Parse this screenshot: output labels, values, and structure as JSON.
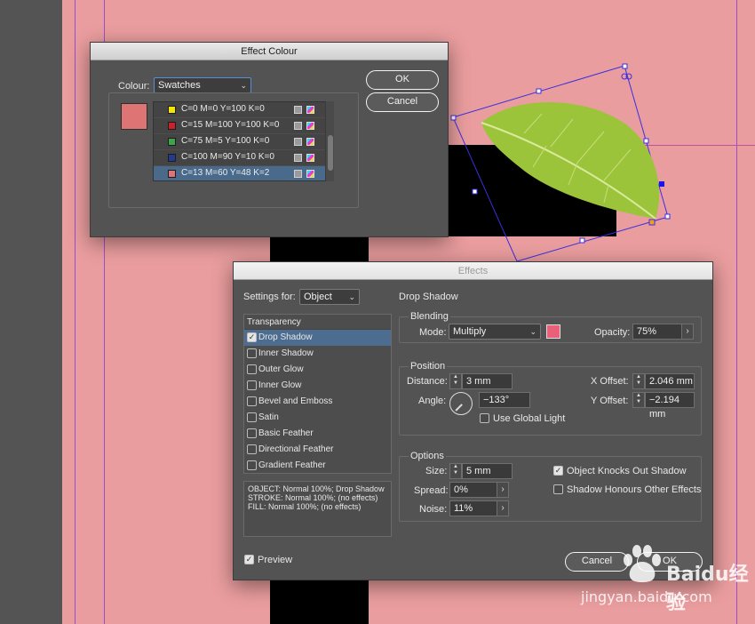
{
  "effect_colour_dialog": {
    "title": "Effect Colour",
    "colour_label": "Colour:",
    "colour_value": "Swatches",
    "ok_label": "OK",
    "cancel_label": "Cancel",
    "preview_color": "#de7474",
    "swatches": [
      {
        "name": "C=0 M=0 Y=100 K=0",
        "color": "#f2e600",
        "selected": false
      },
      {
        "name": "C=15 M=100 Y=100 K=0",
        "color": "#c8202c",
        "selected": false
      },
      {
        "name": "C=75 M=5 Y=100 K=0",
        "color": "#3ca54a",
        "selected": false
      },
      {
        "name": "C=100 M=90 Y=10 K=0",
        "color": "#223b8f",
        "selected": false
      },
      {
        "name": "C=13 M=60 Y=48 K=2",
        "color": "#de7474",
        "selected": true
      }
    ]
  },
  "effects_dialog": {
    "title": "Effects",
    "settings_for_label": "Settings for:",
    "settings_for_value": "Object",
    "section_title": "Drop Shadow",
    "list_header": "Transparency",
    "effects": [
      {
        "label": "Drop Shadow",
        "checked": true,
        "selected": true
      },
      {
        "label": "Inner Shadow",
        "checked": false,
        "selected": false
      },
      {
        "label": "Outer Glow",
        "checked": false,
        "selected": false
      },
      {
        "label": "Inner Glow",
        "checked": false,
        "selected": false
      },
      {
        "label": "Bevel and Emboss",
        "checked": false,
        "selected": false
      },
      {
        "label": "Satin",
        "checked": false,
        "selected": false
      },
      {
        "label": "Basic Feather",
        "checked": false,
        "selected": false
      },
      {
        "label": "Directional Feather",
        "checked": false,
        "selected": false
      },
      {
        "label": "Gradient Feather",
        "checked": false,
        "selected": false
      }
    ],
    "summary": [
      "OBJECT: Normal 100%; Drop Shadow",
      "STROKE: Normal 100%; (no effects)",
      "FILL: Normal 100%; (no effects)"
    ],
    "blending": {
      "title": "Blending",
      "mode_label": "Mode:",
      "mode_value": "Multiply",
      "opacity_label": "Opacity:",
      "opacity_value": "75%",
      "shadow_color": "#e8607a"
    },
    "position": {
      "title": "Position",
      "distance_label": "Distance:",
      "distance_value": "3 mm",
      "angle_label": "Angle:",
      "angle_value": "−133°",
      "use_global_light_label": "Use Global Light",
      "use_global_light": false,
      "x_offset_label": "X Offset:",
      "x_offset_value": "2.046 mm",
      "y_offset_label": "Y Offset:",
      "y_offset_value": "−2.194 mm"
    },
    "options": {
      "title": "Options",
      "size_label": "Size:",
      "size_value": "5 mm",
      "spread_label": "Spread:",
      "spread_value": "0%",
      "noise_label": "Noise:",
      "noise_value": "11%",
      "knocks_out_label": "Object Knocks Out Shadow",
      "knocks_out": true,
      "honours_label": "Shadow Honours Other Effects",
      "honours": false
    },
    "preview_label": "Preview",
    "preview_checked": true,
    "cancel_label": "Cancel",
    "ok_label": "OK"
  },
  "watermark": {
    "brand": "Baidu经验",
    "url": "jingyan.baidu.com"
  }
}
